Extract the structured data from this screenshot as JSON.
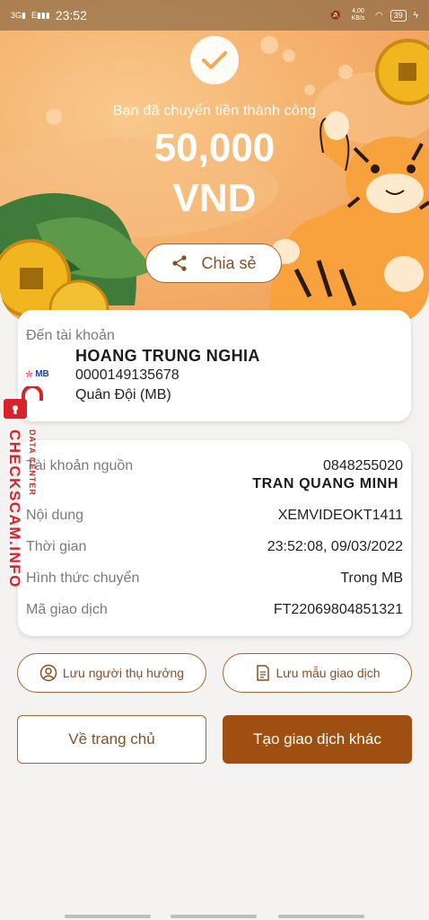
{
  "status_bar": {
    "network": "3G",
    "network2": "E",
    "time": "23:52",
    "speed": "4,00 KB/s",
    "battery": "39"
  },
  "hero": {
    "success_text": "Bạn đã chuyển tiền thành công",
    "amount": "50,000",
    "currency": "VND",
    "share_label": "Chia sẻ"
  },
  "destination": {
    "label": "Đến tài khoản",
    "name": "HOANG TRUNG NGHIA",
    "account": "0000149135678",
    "bank": "Quân Đội (MB)",
    "bank_logo": "MB"
  },
  "details": [
    {
      "label": "Tài khoản nguồn",
      "value": "0848255020",
      "extra": "TRAN QUANG MINH"
    },
    {
      "label": "Nội dung",
      "value": "XEMVIDEOKT1411"
    },
    {
      "label": "Thời gian",
      "value": "23:52:08, 09/03/2022"
    },
    {
      "label": "Hình thức chuyển",
      "value": "Trong MB"
    },
    {
      "label": "Mã giao dịch",
      "value": "FT22069804851321"
    }
  ],
  "actions": {
    "save_beneficiary": "Lưu người thụ hưởng",
    "save_template": "Lưu mẫu giao dịch",
    "home": "Về trang chủ",
    "new_transaction": "Tạo giao dịch khác"
  },
  "watermark": {
    "main": "CHECKSCAM.INFO",
    "sub": "DATA CENTER"
  },
  "colors": {
    "accent": "#a9652d",
    "primary_button": "#a04f12",
    "hero_orange": "#f5b26e"
  }
}
